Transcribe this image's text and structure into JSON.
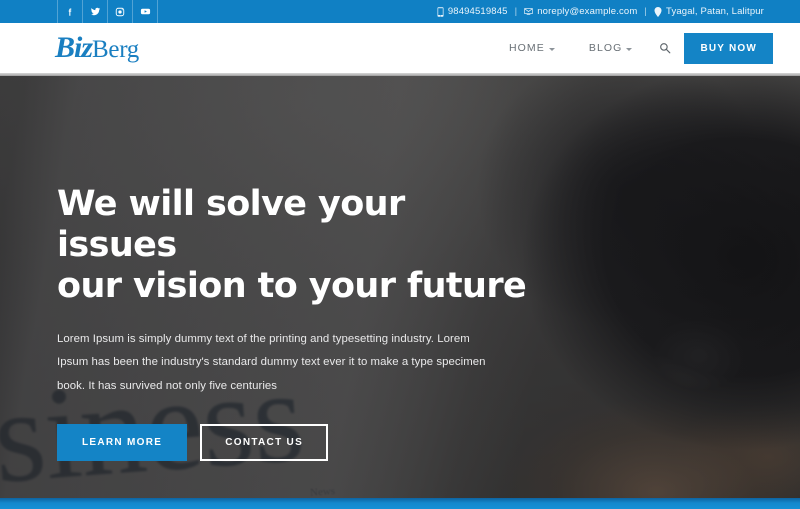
{
  "topbar": {
    "social": [
      {
        "name": "facebook-icon",
        "label": "Facebook"
      },
      {
        "name": "twitter-icon",
        "label": "Twitter"
      },
      {
        "name": "instagram-icon",
        "label": "Instagram"
      },
      {
        "name": "youtube-icon",
        "label": "YouTube"
      }
    ],
    "phone": "98494519845",
    "email": "noreply@example.com",
    "address": "Tyagal, Patan, Lalitpur",
    "separator": "|"
  },
  "header": {
    "logo_mark": "Biz",
    "logo_rest": "Berg",
    "nav": [
      {
        "label": "HOME",
        "has_caret": true
      },
      {
        "label": "BLOG",
        "has_caret": true
      }
    ],
    "search_icon": "search-icon",
    "buy_label": "BUY NOW"
  },
  "hero": {
    "title_line1": "We will solve your issues",
    "title_line2": "our vision to your future",
    "description": "Lorem Ipsum is simply dummy text of the printing and typesetting industry. Lorem Ipsum has been the industry's standard dummy text ever it to make a type specimen book. It has survived not only five centuries",
    "primary_button": "LEARN MORE",
    "secondary_button": "CONTACT US",
    "background_newspaper_word": "isiness",
    "background_newspaper_sub": "News"
  },
  "colors": {
    "brand_blue": "#1484c6",
    "topbar_blue": "#1080c4",
    "logo_blue": "#1a7fc1",
    "nav_text": "#686f75"
  }
}
